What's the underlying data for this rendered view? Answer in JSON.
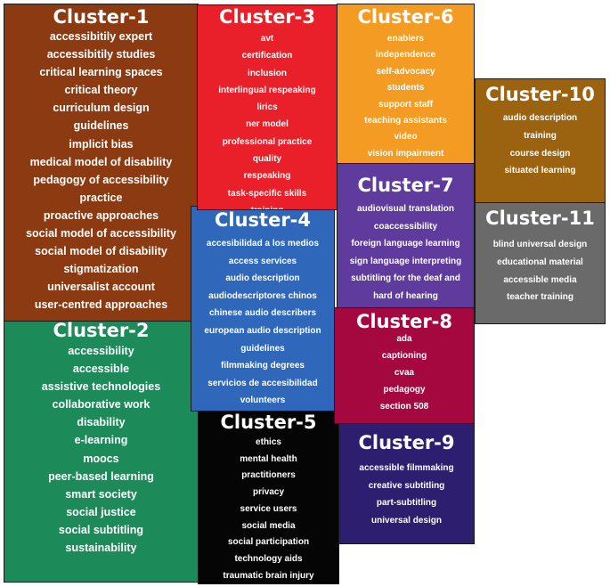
{
  "diagram": {
    "type": "cluster-map",
    "clusters": [
      {
        "id": "cluster-1",
        "title": "Cluster-1",
        "color": "#8B3A12",
        "items": [
          "accessibitily expert",
          "accessibitily studies",
          "critical learning spaces",
          "critical theory",
          "curriculum design",
          "guidelines",
          "implicit bias",
          "medical model of disability",
          "pedagogy of accessibility",
          "practice",
          "proactive approaches",
          "social model of accessibility",
          "social model of disability",
          "stigmatization",
          "universalist account",
          "user-centred approaches"
        ]
      },
      {
        "id": "cluster-2",
        "title": "Cluster-2",
        "color": "#1C8A59",
        "items": [
          "accessibility",
          "accessible",
          "assistive technologies",
          "collaborative work",
          "disability",
          "e-learning",
          "moocs",
          "peer-based learning",
          "smart society",
          "social justice",
          "social subtitling",
          "sustainability"
        ]
      },
      {
        "id": "cluster-3",
        "title": "Cluster-3",
        "color": "#E92029",
        "items": [
          "avt",
          "certification",
          "inclusion",
          "interlingual respeaking",
          "lirics",
          "ner model",
          "professional practice",
          "quality",
          "respeaking",
          "task-specific skills",
          "training"
        ]
      },
      {
        "id": "cluster-4",
        "title": "Cluster-4",
        "color": "#2F68BA",
        "items": [
          "accesibilidad a los medios",
          "access services",
          "audio description",
          "audiodescriptores chinos",
          "chinese audio describers",
          "european audio description",
          "guidelines",
          "filmmaking degrees",
          "servicios de accesibilidad",
          "volunteers"
        ]
      },
      {
        "id": "cluster-5",
        "title": "Cluster-5",
        "color": "#050505",
        "items": [
          "ethics",
          "mental health",
          "practitioners",
          "privacy",
          "service users",
          "social media",
          "social participation",
          "technology aids",
          "traumatic brain injury"
        ]
      },
      {
        "id": "cluster-6",
        "title": "Cluster-6",
        "color": "#F39B22",
        "items": [
          "enablers",
          "independence",
          "self-advocacy",
          "students",
          "support staff",
          "teaching assistants",
          "video",
          "vision impairment"
        ]
      },
      {
        "id": "cluster-7",
        "title": "Cluster-7",
        "color": "#5E3B9C",
        "items": [
          "audiovisual translation",
          "coaccessibility",
          "foreign language learning",
          "sign language interpreting",
          "subtitling for the deaf and",
          "hard of hearing"
        ]
      },
      {
        "id": "cluster-8",
        "title": "Cluster-8",
        "color": "#A5073F",
        "items": [
          "ada",
          "captioning",
          "cvaa",
          "pedagogy",
          "section 508"
        ]
      },
      {
        "id": "cluster-9",
        "title": "Cluster-9",
        "color": "#2E1E6F",
        "items": [
          "accessible filmmaking",
          "creative subtitling",
          "part-subtitling",
          "universal design"
        ]
      },
      {
        "id": "cluster-10",
        "title": "Cluster-10",
        "color": "#9B6310",
        "items": [
          "audio description",
          "training",
          "course design",
          "situated learning"
        ]
      },
      {
        "id": "cluster-11",
        "title": "Cluster-11",
        "color": "#6A6A6A",
        "items": [
          "blind universal design",
          "educational material",
          "accessible media",
          "teacher training"
        ]
      }
    ]
  }
}
